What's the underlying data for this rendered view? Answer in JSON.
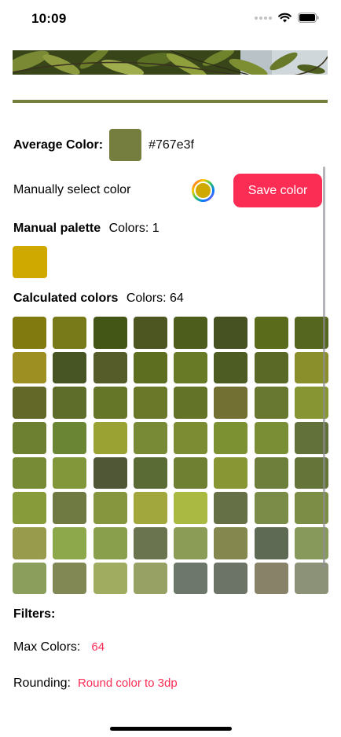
{
  "status_bar": {
    "time": "10:09",
    "icons": [
      "signal-dots-icon",
      "wifi-icon",
      "battery-icon"
    ]
  },
  "photo_strip": {
    "description_icon": "leaves-photo"
  },
  "average": {
    "label": "Average Color:",
    "color": "#767e3f",
    "hex": "#767e3f"
  },
  "manual": {
    "label": "Manually select color",
    "picker_color": "#cfa800",
    "save_label": "Save color"
  },
  "palette": {
    "label": "Manual palette",
    "count_text": "Colors: 1",
    "colors": [
      "#cfa800"
    ]
  },
  "calculated": {
    "label": "Calculated colors",
    "count_text": "Colors: 64",
    "colors": [
      "#817a0e",
      "#787918",
      "#435616",
      "#4d5620",
      "#4d5d1c",
      "#465222",
      "#5a6b1c",
      "#55661e",
      "#9e8f23",
      "#475423",
      "#565b2a",
      "#5e6e21",
      "#697a27",
      "#4d5c22",
      "#5a6a26",
      "#8a8f2c",
      "#636728",
      "#5f6d2b",
      "#667628",
      "#6a782a",
      "#637429",
      "#727032",
      "#697830",
      "#879532",
      "#6d7f30",
      "#6a8533",
      "#99a233",
      "#798a36",
      "#7c8c33",
      "#7b9132",
      "#7a8e36",
      "#62703a",
      "#778a36",
      "#82963a",
      "#4f5737",
      "#5b6b36",
      "#6f8033",
      "#889633",
      "#6e7f3b",
      "#657539",
      "#879b3a",
      "#6f7a42",
      "#85963e",
      "#a1a63d",
      "#a9b941",
      "#667047",
      "#7a8c47",
      "#7c8d46",
      "#979b4b",
      "#8da74b",
      "#899f4c",
      "#6a744f",
      "#8b9c56",
      "#84884e",
      "#5f6a55",
      "#889a5b",
      "#8c9e5b",
      "#818853",
      "#a0ad60",
      "#97a163",
      "#6e776b",
      "#6c7468",
      "#878268",
      "#8c9278"
    ]
  },
  "filters": {
    "title": "Filters:",
    "max_colors_label": "Max Colors:",
    "max_colors_value": "64",
    "rounding_label": "Rounding:",
    "rounding_value": "Round color to 3dp"
  },
  "theme": {
    "accent": "#fb2d55",
    "divider": "#767e3f"
  }
}
